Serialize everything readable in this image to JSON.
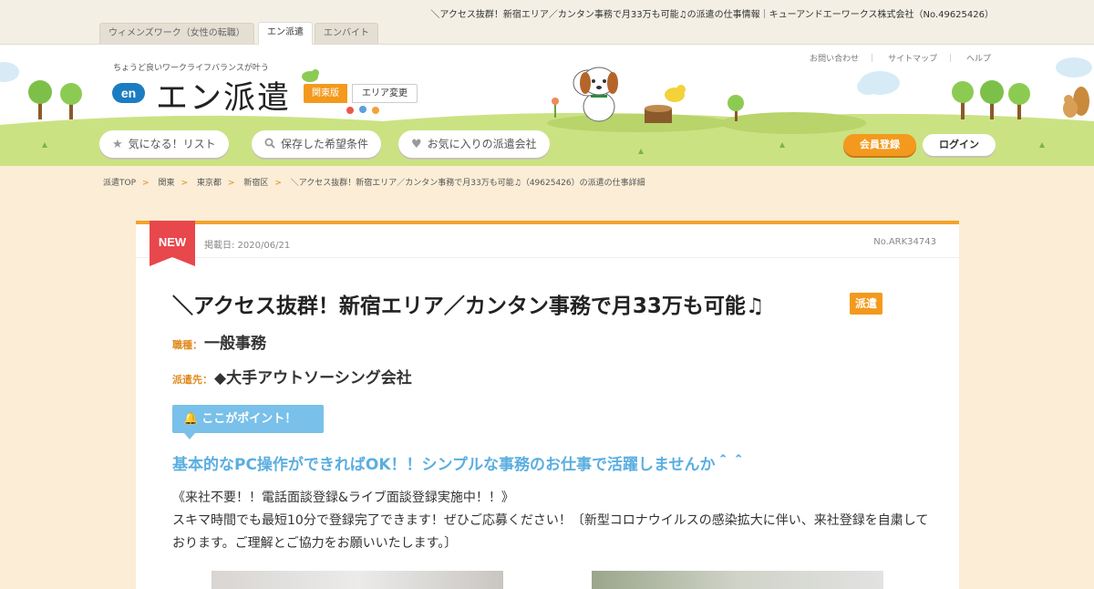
{
  "page_title": "＼アクセス抜群！新宿エリア／カンタン事務で月33万も可能♫の派遣の仕事情報｜キューアンドエーワークス株式会社（No.49625426）",
  "site_tabs": [
    {
      "label": "ウィメンズワーク（女性の転職）"
    },
    {
      "label": "エン派遣"
    },
    {
      "label": "エンバイト"
    }
  ],
  "header": {
    "tagline": "ちょうど良いワークライフバランスが叶う",
    "logo_mark": "en",
    "logo_text": "エン派遣",
    "region": "関東版",
    "area_change": "エリア変更",
    "util_links": [
      "お問い合わせ",
      "サイトマップ",
      "ヘルプ"
    ]
  },
  "nav": {
    "items": [
      {
        "label": "気になる！リスト",
        "icon": "star-icon"
      },
      {
        "label": "保存した希望条件",
        "icon": "search-icon"
      },
      {
        "label": "お気に入りの派遣会社",
        "icon": "heart-icon"
      }
    ],
    "register": "会員登録",
    "login": "ログイン"
  },
  "breadcrumb": [
    "派遣TOP",
    "関東",
    "東京都",
    "新宿区",
    "＼アクセス抜群！新宿エリア／カンタン事務で月33万も可能♫（49625426）の派遣の仕事詳細"
  ],
  "job": {
    "new_label": "NEW",
    "posted": "掲載日: 2020/06/21",
    "job_no": "No.ARK34743",
    "title": "＼アクセス抜群！新宿エリア／カンタン事務で月33万も可能♫",
    "type_badge": "派遣",
    "job_type_label": "職種：",
    "job_type": "一般事務",
    "dispatch_label": "派遣先：",
    "dispatch": "◆大手アウトソーシング会社",
    "point_label": "ここがポイント！",
    "catch": "基本的なPC操作ができればOK！！シンプルな事務のお仕事で活躍しませんか＾＾",
    "body_line1": "《来社不要！！電話面談登録&ライブ面談登録実施中！！》",
    "body_line2": "スキマ時間でも最短10分で登録完了できます！ぜひご応募ください！〔新型コロナウイルスの感染拡大に伴い、来社登録を自粛しております。ご理解とご協力をお願いいたします。〕"
  },
  "colors": {
    "accent": "#f39a1e",
    "link_blue": "#5aaee0",
    "logo_blue": "#1c7cc2",
    "page_bg": "#fbedd6"
  }
}
